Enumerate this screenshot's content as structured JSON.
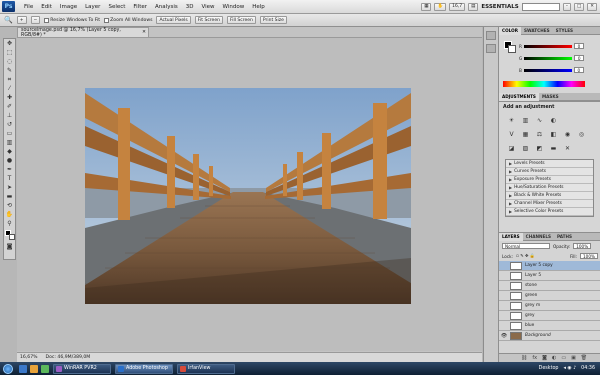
{
  "app": {
    "logo": "Ps",
    "workspace": "ESSENTIALS",
    "zoom_field": "16,7"
  },
  "menu": [
    "File",
    "Edit",
    "Image",
    "Layer",
    "Select",
    "Filter",
    "Analysis",
    "3D",
    "View",
    "Window",
    "Help"
  ],
  "options": {
    "chk_resize": "Resize Windows To Fit",
    "chk_zoom_all": "Zoom All Windows",
    "btn_actual": "Actual Pixels",
    "btn_fit": "Fit Screen",
    "btn_fill": "Fill Screen",
    "btn_print": "Print Size"
  },
  "document": {
    "tab": "sourceimage.psd @ 16,7% (Layer 5 copy, RGB/8#) *",
    "zoom": "16,67%",
    "doc_size": "Doc: 46,9M/389,0M"
  },
  "color_panel": {
    "tabs": [
      "COLOR",
      "SWATCHES",
      "STYLES"
    ],
    "channels": [
      {
        "label": "R",
        "value": "0"
      },
      {
        "label": "G",
        "value": "0"
      },
      {
        "label": "B",
        "value": "0"
      }
    ]
  },
  "adjustments": {
    "tab": "ADJUSTMENTS",
    "masks_tab": "MASKS",
    "title": "Add an adjustment",
    "presets": [
      "Levels Presets",
      "Curves Presets",
      "Exposure Presets",
      "Hue/Saturation Presets",
      "Black & White Presets",
      "Channel Mixer Presets",
      "Selective Color Presets"
    ]
  },
  "layers_panel": {
    "tabs": [
      "LAYERS",
      "CHANNELS",
      "PATHS"
    ],
    "blend_mode": "Normal",
    "opacity_label": "Opacity:",
    "opacity": "100%",
    "lock_label": "Lock:",
    "fill_label": "Fill:",
    "fill": "100%",
    "layers": [
      "Layer 5 copy",
      "Layer 5",
      "stone",
      "green",
      "grey m",
      "grey",
      "blue",
      "Background"
    ]
  },
  "taskbar": {
    "items": [
      "WinRAR PVR2",
      "Adobe Photoshop",
      "IrfanView"
    ],
    "desktop": "Desktop",
    "clock": "04:36"
  }
}
